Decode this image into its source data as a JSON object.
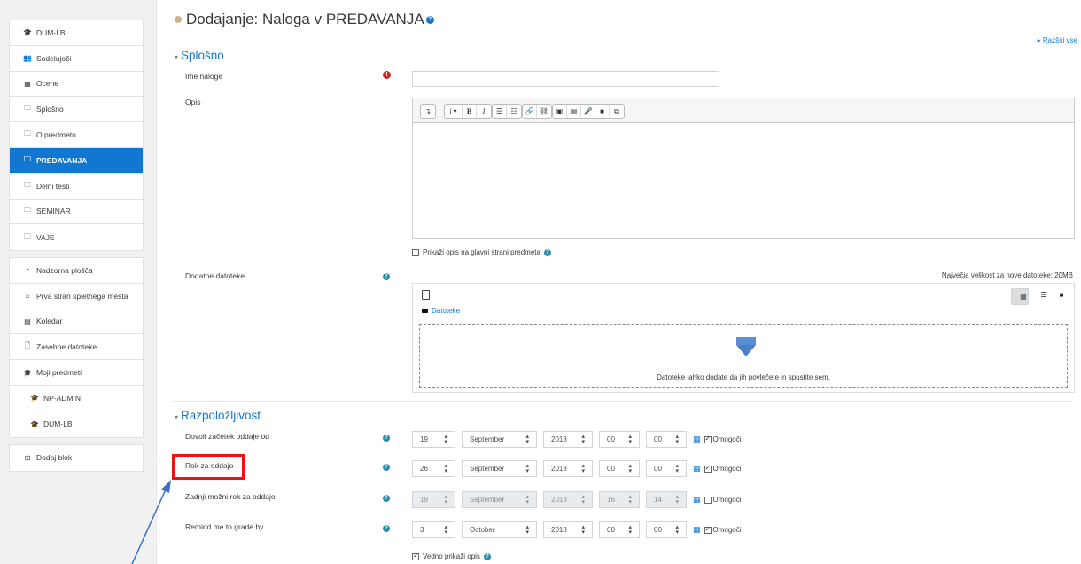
{
  "sidebar": {
    "course_items": [
      {
        "label": "DUM-LB",
        "icon": "graduation-cap-icon",
        "glyph": "🎓"
      },
      {
        "label": "Sodelujoči",
        "icon": "users-icon",
        "glyph": "👥"
      },
      {
        "label": "Ocene",
        "icon": "table-icon",
        "glyph": "▦"
      },
      {
        "label": "Splošno",
        "icon": "folder-icon",
        "glyph": "🗀"
      },
      {
        "label": "O predmetu",
        "icon": "folder-icon",
        "glyph": "🗀"
      },
      {
        "label": "PREDAVANJA",
        "icon": "folder-icon",
        "glyph": "🗀",
        "active": true
      },
      {
        "label": "Delni testi",
        "icon": "folder-icon",
        "glyph": "🗀"
      },
      {
        "label": "SEMINAR",
        "icon": "folder-icon",
        "glyph": "🗀"
      },
      {
        "label": "VAJE",
        "icon": "folder-icon",
        "glyph": "🗀"
      }
    ],
    "site_items": [
      {
        "label": "Nadzorna plošča",
        "icon": "dashboard-icon",
        "glyph": "◔"
      },
      {
        "label": "Prva stran spletnega mesta",
        "icon": "home-icon",
        "glyph": "⌂"
      },
      {
        "label": "Koledar",
        "icon": "calendar-icon",
        "glyph": "▤"
      },
      {
        "label": "Zasebne datoteke",
        "icon": "file-icon",
        "glyph": "🗋"
      },
      {
        "label": "Moji predmeti",
        "icon": "graduation-cap-icon",
        "glyph": "🎓"
      },
      {
        "label": "NP-ADMIN",
        "icon": "graduation-cap-icon",
        "glyph": "🎓",
        "indent": true
      },
      {
        "label": "DUM-LB",
        "icon": "graduation-cap-icon",
        "glyph": "🎓",
        "indent": true
      }
    ],
    "add_block": {
      "label": "Dodaj blok",
      "icon": "plus-square-icon",
      "glyph": "⊞"
    }
  },
  "page": {
    "title": "Dodajanje: Naloga v PREDAVANJA",
    "expand_all": "Razširi vse"
  },
  "general": {
    "header": "Splošno",
    "name_label": "Ime naloge",
    "name_value": "",
    "desc_label": "Opis",
    "toolbar_groups": [
      [
        "↴"
      ],
      [
        "i ▾",
        "B",
        "I"
      ],
      [
        "☰",
        "☷"
      ],
      [
        "🔗",
        "⛓"
      ],
      [
        "▣",
        "▤",
        "🎤",
        "■",
        "⧉"
      ]
    ],
    "show_desc_label": "Prikaži opis na glavni strani predmeta",
    "show_desc_checked": false,
    "files_label": "Dodatne datoteke",
    "max_size": "Največja velikost za nove datoteke: 20MB",
    "files_folder": "Datoteke",
    "drop_text": "Datoteke lahko dodate da jih povlečete in spustite sem."
  },
  "availability": {
    "header": "Razpoložljivost",
    "rows": [
      {
        "label": "Dovoli začetek oddaje od",
        "day": "19",
        "month": "September",
        "year": "2018",
        "hour": "00",
        "minute": "00",
        "enabled": true,
        "enable_label": "Omogoči"
      },
      {
        "label": "Rok za oddajo",
        "day": "26",
        "month": "September",
        "year": "2018",
        "hour": "00",
        "minute": "00",
        "enabled": true,
        "enable_label": "Omogoči"
      },
      {
        "label": "Zadnji možni rok za oddajo",
        "day": "19",
        "month": "September",
        "year": "2018",
        "hour": "16",
        "minute": "14",
        "enabled": false,
        "enable_label": "Omogoči"
      },
      {
        "label": "Remind me to grade by",
        "day": "3",
        "month": "October",
        "year": "2018",
        "hour": "00",
        "minute": "00",
        "enabled": true,
        "enable_label": "Omogoči"
      }
    ],
    "always_show_label": "Vedno prikaži opis",
    "always_show_checked": true
  },
  "colors": {
    "accent": "#1177d1",
    "highlight": "#ee1111",
    "arrow": "#3a6fc4"
  }
}
